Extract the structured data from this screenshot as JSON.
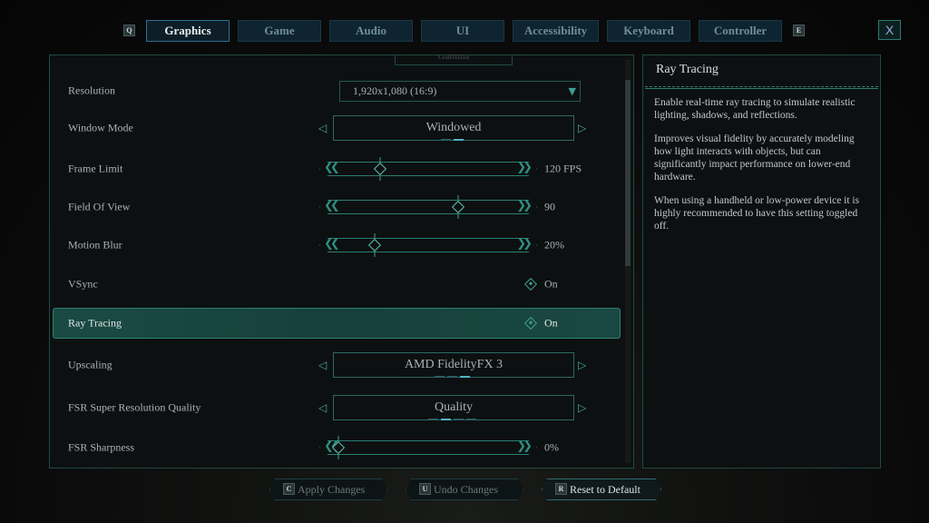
{
  "tabs": {
    "prev_key": "Q",
    "next_key": "E",
    "items": [
      {
        "label": "Graphics",
        "active": true
      },
      {
        "label": "Game"
      },
      {
        "label": "Audio"
      },
      {
        "label": "UI"
      },
      {
        "label": "Accessibility"
      },
      {
        "label": "Keyboard"
      },
      {
        "label": "Controller"
      }
    ],
    "close_label": "X"
  },
  "section_header": "Gamma",
  "settings": {
    "resolution": {
      "label": "Resolution",
      "value": "1,920x1,080 (16:9)"
    },
    "window_mode": {
      "label": "Window Mode",
      "value": "Windowed",
      "options_count": 2,
      "selected_index": 1
    },
    "frame_limit": {
      "label": "Frame Limit",
      "value": "120 FPS",
      "fraction": 0.23
    },
    "fov": {
      "label": "Field Of View",
      "value": "90",
      "fraction": 0.66
    },
    "motion_blur": {
      "label": "Motion Blur",
      "value": "20%",
      "fraction": 0.2
    },
    "vsync": {
      "label": "VSync",
      "value": "On"
    },
    "ray_tracing": {
      "label": "Ray Tracing",
      "value": "On"
    },
    "upscaling": {
      "label": "Upscaling",
      "value": "AMD FidelityFX 3",
      "options_count": 3,
      "selected_index": 2
    },
    "fsr_quality": {
      "label": "FSR Super Resolution Quality",
      "value": "Quality",
      "options_count": 4,
      "selected_index": 1
    },
    "fsr_sharpness": {
      "label": "FSR Sharpness",
      "value": "0%",
      "fraction": 0.0
    }
  },
  "info": {
    "title": "Ray Tracing",
    "paragraphs": [
      "Enable real-time ray tracing to simulate realistic lighting, shadows, and reflections.",
      "Improves visual fidelity by accurately modeling how light interacts with objects, but can significantly impact performance on lower-end hardware.",
      "When using a handheld or low-power device it is highly recommended to have this setting toggled off."
    ]
  },
  "footer": {
    "apply": {
      "key": "C",
      "label": "Apply Changes"
    },
    "undo": {
      "key": "U",
      "label": "Undo Changes"
    },
    "reset": {
      "key": "R",
      "label": "Reset to Default"
    }
  },
  "colors": {
    "accent": "#3fa090",
    "highlight": "#1a4a44"
  }
}
